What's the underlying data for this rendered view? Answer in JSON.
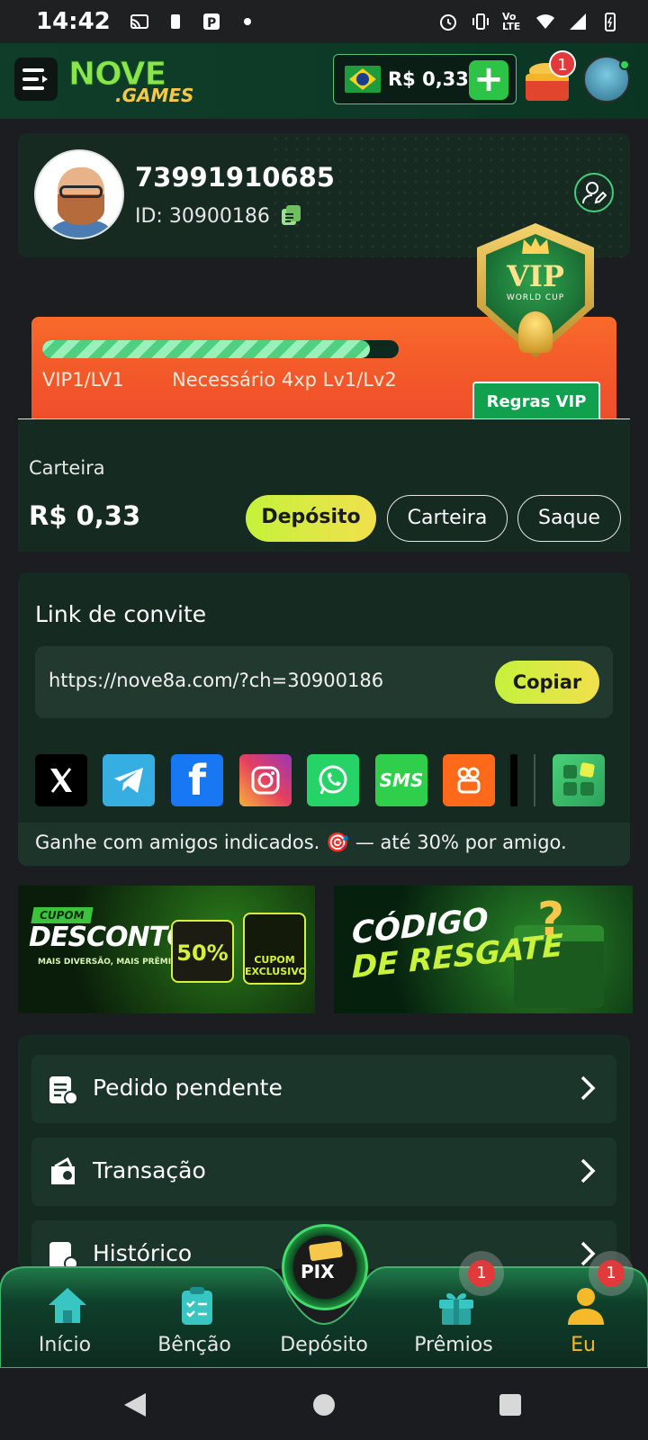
{
  "status_bar": {
    "time": "14:42",
    "lte": "Vo LTE"
  },
  "header": {
    "logo_line1": "NOVE",
    "logo_line2": ".GAMES",
    "balance": "R$ 0,33",
    "chest_badge": "1"
  },
  "profile": {
    "name": "73991910685",
    "id_text": "ID: 30900186"
  },
  "vip": {
    "badge_title": "VIP",
    "badge_sub": "WORLD CUP",
    "progress_fraction": 0.92,
    "level": "VIP1/LV1",
    "requirement": "Necessário 4xp Lv1/Lv2",
    "rules_button": "Regras VIP"
  },
  "wallet": {
    "label": "Carteira",
    "amount": "R$ 0,33",
    "buttons": {
      "deposit": "Depósito",
      "wallet": "Carteira",
      "withdraw": "Saque"
    }
  },
  "invite": {
    "title": "Link de convite",
    "link": "https://nove8a.com/?ch=30900186",
    "copy_button": "Copiar",
    "socials": [
      {
        "name": "x",
        "label": "X",
        "color": "#000000"
      },
      {
        "name": "telegram",
        "label": "",
        "color": "#37aee2"
      },
      {
        "name": "facebook",
        "label": "f",
        "color": "#1877f2"
      },
      {
        "name": "instagram",
        "label": "",
        "color": "#e4405f"
      },
      {
        "name": "whatsapp",
        "label": "",
        "color": "#25d366"
      },
      {
        "name": "sms",
        "label": "SMS",
        "color": "#2fcf4c"
      },
      {
        "name": "kwai",
        "label": "",
        "color": "#ff6a1a"
      }
    ],
    "footer": "Ganhe com amigos indicados. 🎯 — até 30% por amigo."
  },
  "banners": {
    "b1": {
      "tag": "CUPOM",
      "title": "DESCONTO",
      "sub": "MAIS DIVERSÃO, MAIS PRÊMIOS!",
      "percent": "50%",
      "ticket": "CUPOM EXCLUSIVO"
    },
    "b2": {
      "line1": "CÓDIGO",
      "line2": "DE RESGATE"
    }
  },
  "menu": [
    {
      "label": "Pedido pendente"
    },
    {
      "label": "Transação"
    },
    {
      "label": "Histórico"
    }
  ],
  "bottom_nav": {
    "items": [
      {
        "label": "Início"
      },
      {
        "label": "Bênção"
      },
      {
        "label": "Depósito"
      },
      {
        "label": "Prêmios",
        "badge": "1"
      },
      {
        "label": "Eu",
        "badge": "1"
      }
    ],
    "pix_label": "PIX"
  },
  "colors": {
    "accent_green": "#2dc346",
    "accent_yellow": "#f1e04d",
    "vip_orange": "#f35a2a",
    "active_nav": "#f5b92a"
  }
}
